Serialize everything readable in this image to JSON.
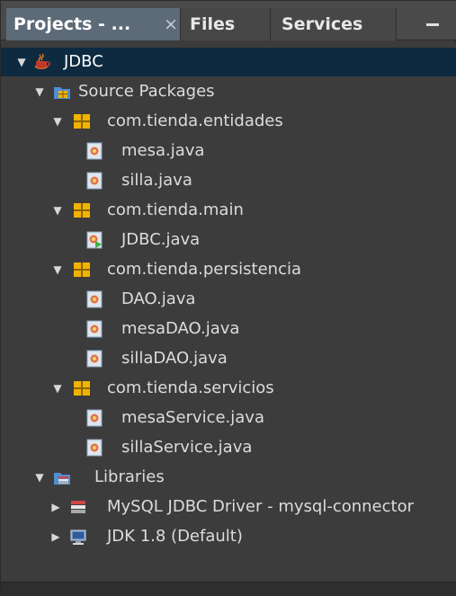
{
  "tabs": {
    "projects": "Projects - ...",
    "close": "×",
    "files": "Files",
    "services": "Services"
  },
  "tree": {
    "project": "JDBC",
    "source_packages": "Source Packages",
    "packages": [
      {
        "name": "com.tienda.entidades",
        "files": [
          "mesa.java",
          "silla.java"
        ]
      },
      {
        "name": "com.tienda.main",
        "files": [
          "JDBC.java"
        ]
      },
      {
        "name": "com.tienda.persistencia",
        "files": [
          "DAO.java",
          "mesaDAO.java",
          "sillaDAO.java"
        ]
      },
      {
        "name": "com.tienda.servicios",
        "files": [
          "mesaService.java",
          "sillaService.java"
        ]
      }
    ],
    "libraries": "Libraries",
    "library_items": [
      "MySQL JDBC Driver - mysql-connector",
      "JDK 1.8 (Default)"
    ]
  },
  "colors": {
    "background": "#3c3c3c",
    "selected_row": "#0d2a40",
    "active_tab": "#5d6a78",
    "package_icon": "#e8a800"
  }
}
